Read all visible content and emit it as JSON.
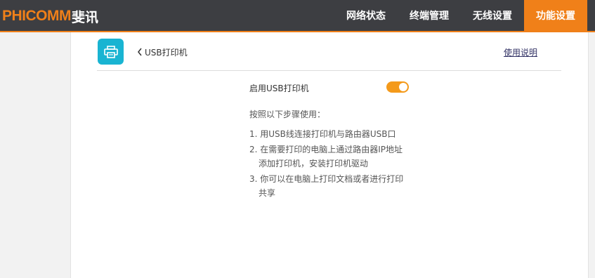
{
  "header": {
    "logo_en": "PHICOMM",
    "logo_cn": "斐讯",
    "nav": [
      {
        "label": "网络状态",
        "active": false
      },
      {
        "label": "终端管理",
        "active": false
      },
      {
        "label": "无线设置",
        "active": false
      },
      {
        "label": "功能设置",
        "active": true
      }
    ]
  },
  "page": {
    "icon": "printer-icon",
    "back_label": "USB打印机",
    "help_link": "使用说明"
  },
  "settings": {
    "enable_label": "启用USB打印机",
    "enabled": true
  },
  "instructions": {
    "intro": "按照以下步骤使用：",
    "lines": [
      "1. 用USB线连接打印机与路由器USB口",
      "2. 在需要打印的电脑上通过路由器IP地址",
      "添加打印机，安装打印机驱动",
      "3. 你可以在电脑上打印文档或者进行打印",
      "共享"
    ]
  },
  "colors": {
    "brand": "#f08019",
    "header_bg": "#3d3e42",
    "tile": "#19b4d2",
    "toggle_on": "#f49a1b"
  }
}
